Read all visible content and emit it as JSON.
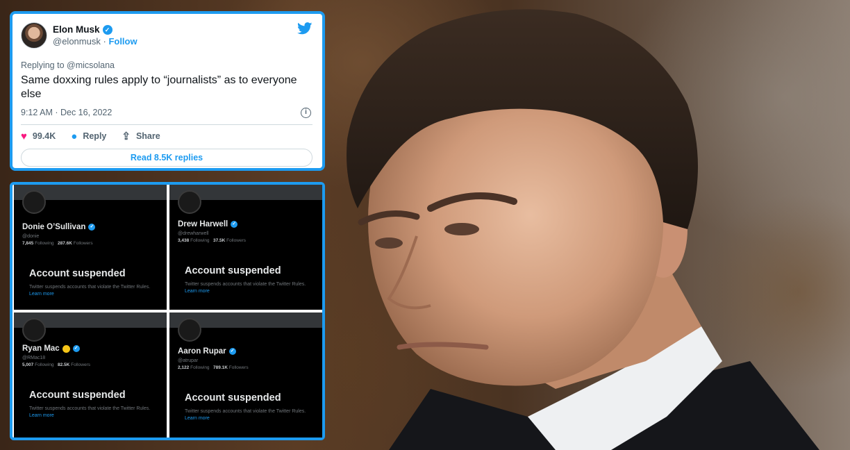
{
  "tweet": {
    "display_name": "Elon Musk",
    "handle": "@elonmusk",
    "separator": "·",
    "follow_label": "Follow",
    "replying_to": "Replying to @micsolana",
    "text": "Same doxxing rules apply to “journalists” as to everyone else",
    "timestamp": "9:12 AM · Dec 16, 2022",
    "likes": "99.4K",
    "reply_label": "Reply",
    "share_label": "Share",
    "read_replies_label": "Read 8.5K replies",
    "icons": [
      "twitter-bird-icon",
      "verified-badge-icon",
      "info-icon",
      "heart-icon",
      "reply-bubble-icon",
      "share-icon"
    ],
    "accent_color": "#1d9bf0",
    "like_color": "#f91880"
  },
  "suspended_accounts": [
    {
      "name": "Donie O’Sullivan",
      "handle": "@donie",
      "following": "7,845",
      "following_label": "Following",
      "followers": "287.6K",
      "followers_label": "Followers",
      "status": "Account suspended",
      "description": "Twitter suspends accounts that violate the Twitter Rules.",
      "learn_more": "Learn more"
    },
    {
      "name": "Drew Harwell",
      "handle": "@drewharwell",
      "following": "3,438",
      "following_label": "Following",
      "followers": "37.5K",
      "followers_label": "Followers",
      "status": "Account suspended",
      "description": "Twitter suspends accounts that violate the Twitter Rules.",
      "learn_more": "Learn more"
    },
    {
      "name": "Ryan Mac",
      "handle": "@RMac18",
      "following": "5,007",
      "following_label": "Following",
      "followers": "82.5K",
      "followers_label": "Followers",
      "status": "Account suspended",
      "description": "Twitter suspends accounts that violate the Twitter Rules.",
      "learn_more": "Learn more"
    },
    {
      "name": "Aaron Rupar",
      "handle": "@atrupar",
      "following": "2,122",
      "following_label": "Following",
      "followers": "789.1K",
      "followers_label": "Followers",
      "status": "Account suspended",
      "description": "Twitter suspends accounts that violate the Twitter Rules.",
      "learn_more": "Learn more"
    }
  ],
  "colors": {
    "frame_border": "#1d9bf0",
    "dark_card": "#000000"
  }
}
